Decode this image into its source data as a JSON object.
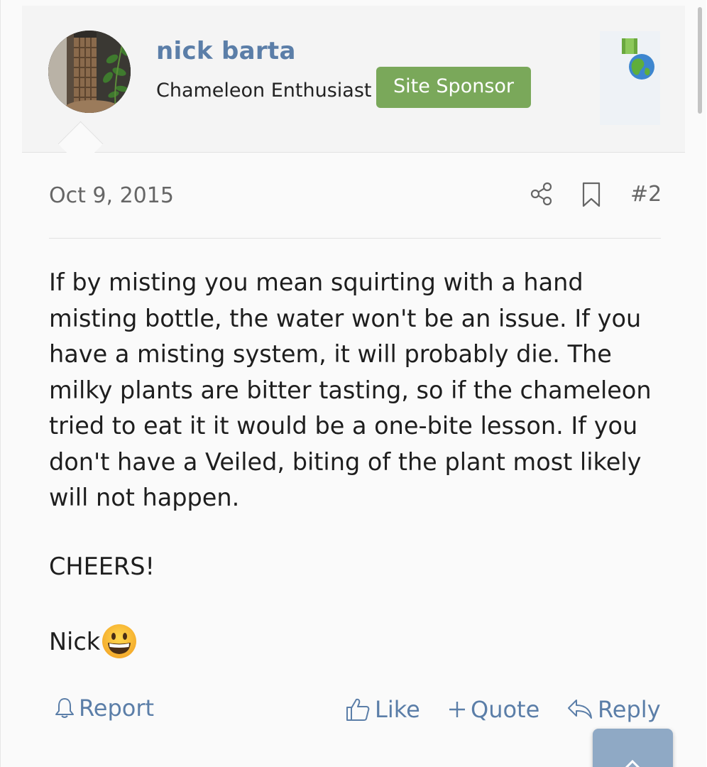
{
  "user": {
    "name": "nick barta",
    "title": "Chameleon Enthusiast",
    "badge": "Site Sponsor",
    "avatar_icon": "avatar-photo",
    "trophy_icon": "globe-medal-icon"
  },
  "post": {
    "date": "Oct 9, 2015",
    "number": "#2",
    "body": "If by misting you mean squirting with a hand misting bottle, the water won't be an issue. If you have a misting system, it will probably die. The milky plants are bitter tasting, so if the chameleon tried to eat it it would be a one-bite lesson. If you don't have a Veiled, biting of the plant most likely will not happen.",
    "signoff": "CHEERS!",
    "signature": "Nick",
    "signature_emoji": "grinning-face-emoji"
  },
  "actions": {
    "report": "Report",
    "like": "Like",
    "quote": "Quote",
    "reply": "Reply"
  },
  "colors": {
    "link": "#5b7ea8",
    "badge_bg": "#7aa85a",
    "scroll_button": "#8fa9c5"
  }
}
